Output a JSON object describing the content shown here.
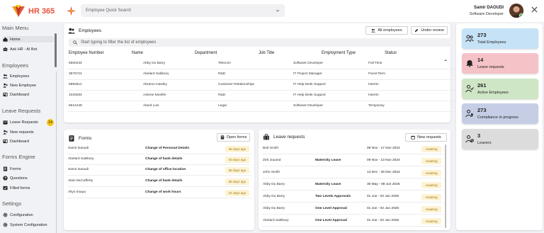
{
  "app": {
    "name": "HR 365"
  },
  "search": {
    "placeholder": "Employee Quick Search"
  },
  "user": {
    "name": "Samir DAOUDI",
    "role": "Software Developer"
  },
  "sidebar": {
    "sections": [
      {
        "title": "Main Menu",
        "items": [
          {
            "label": "Home",
            "icon": "home-icon"
          },
          {
            "label": "Ask HR - AI Bot",
            "icon": "bot-icon"
          }
        ]
      },
      {
        "title": "Employees",
        "items": [
          {
            "label": "Employees",
            "icon": "users-icon"
          },
          {
            "label": "New Employee",
            "icon": "user-plus-icon"
          },
          {
            "label": "Dashboard",
            "icon": "dashboard-icon"
          }
        ]
      },
      {
        "title": "Leave Requests",
        "items": [
          {
            "label": "Leave Requests",
            "icon": "leave-icon",
            "badge": "14"
          },
          {
            "label": "New requests",
            "icon": "new-request-icon"
          },
          {
            "label": "Dashboard",
            "icon": "dashboard-icon"
          }
        ]
      },
      {
        "title": "Forms Engine",
        "items": [
          {
            "label": "Forms",
            "icon": "forms-icon"
          },
          {
            "label": "Questions",
            "icon": "question-icon"
          },
          {
            "label": "Filled forms",
            "icon": "filled-forms-icon"
          }
        ]
      },
      {
        "title": "Settings",
        "items": [
          {
            "label": "Configuration",
            "icon": "gear-icon"
          },
          {
            "label": "System Configuration",
            "icon": "system-gear-icon"
          }
        ]
      }
    ]
  },
  "employees": {
    "title": "Employees",
    "all_button": "All employees",
    "review_button": "Under review",
    "filter_placeholder": "Start typing to filter the list of employees",
    "columns": [
      "Employee Number",
      "Name",
      "Department",
      "Job Title",
      "Employment Type",
      "Status"
    ],
    "rows": [
      [
        "5560233",
        "Abby Du Barry",
        "Telecom",
        "Software Developer",
        "Full Time",
        ""
      ],
      [
        "3976724",
        "Abelard Salsbury",
        "R&D",
        "IT Project Manager",
        "Fixed-Term",
        ""
      ],
      [
        "8992612",
        "Abramo Hawley",
        "Customer Relationships",
        "IT Help Desk Support",
        "Interim",
        ""
      ],
      [
        "1029283",
        "Adoree Moelfer",
        "R&D",
        "IT Help Desk Support",
        "Interim",
        ""
      ],
      [
        "6614449",
        "Aland Luis",
        "Legal",
        "Software Developer",
        "Temporary",
        ""
      ]
    ]
  },
  "forms": {
    "title": "Forms",
    "open_button": "Open forms",
    "rows": [
      {
        "name": "Samir Daoudi",
        "form": "Change of Personal Details",
        "age": "68 days ago"
      },
      {
        "name": "Abelard Salsbury",
        "form": "Change of bank details",
        "age": "93 days ago"
      },
      {
        "name": "Samir Daoudi",
        "form": "Change of office location",
        "age": "68 days ago"
      },
      {
        "name": "Alain McCafferty",
        "form": "Change of bank details",
        "age": "65 days ago"
      },
      {
        "name": "Allyn Imaya",
        "form": "Change of work hours",
        "age": "31 days ago"
      }
    ]
  },
  "leave": {
    "title": "Leave requests",
    "new_button": "New requests",
    "rows": [
      {
        "name": "Bob Smith",
        "type": "",
        "dates": "09 Nov - 17 Nov 2024",
        "status": "Awaiting"
      },
      {
        "name": "Zeb Jouand",
        "type": "Maternity Leave",
        "dates": "09 Nov - 13 Nov 2024",
        "status": "Awaiting"
      },
      {
        "name": "John Smith",
        "type": "",
        "dates": "13 Dec - 26 Dec 2024",
        "status": "Awaiting"
      },
      {
        "name": "Abby Du Barry",
        "type": "Maternity Leave",
        "dates": "30 May - 08 Jun 2025",
        "status": "Awaiting"
      },
      {
        "name": "Abby Du Barry",
        "type": "Two Levels Approvals",
        "dates": "01 Jun - 02 Jun 2025",
        "status": "Awaiting"
      },
      {
        "name": "Abby Du Barry",
        "type": "One Level Approval",
        "dates": "01 Jun - 02 Jun 2025",
        "status": "Awaiting"
      },
      {
        "name": "Abelard Salsbury",
        "type": "One Level Approval",
        "dates": "01 Jun - 02 Jun 2025",
        "status": "Awaiting"
      }
    ]
  },
  "stats": [
    {
      "value": "273",
      "label": "Total Employees",
      "color": "#c6e2f6",
      "icon": "users-group-icon"
    },
    {
      "value": "14",
      "label": "Leave requests",
      "color": "#f5c2c8",
      "icon": "bell-icon"
    },
    {
      "value": "261",
      "label": "Active Employees",
      "color": "#cfe6c6",
      "icon": "user-check-icon"
    },
    {
      "value": "273",
      "label": "Compliance in progress",
      "color": "#c6cee6",
      "icon": "user-shield-icon"
    },
    {
      "value": "3",
      "label": "Leavers",
      "color": "#dcdcdc",
      "icon": "user-leave-icon"
    }
  ]
}
